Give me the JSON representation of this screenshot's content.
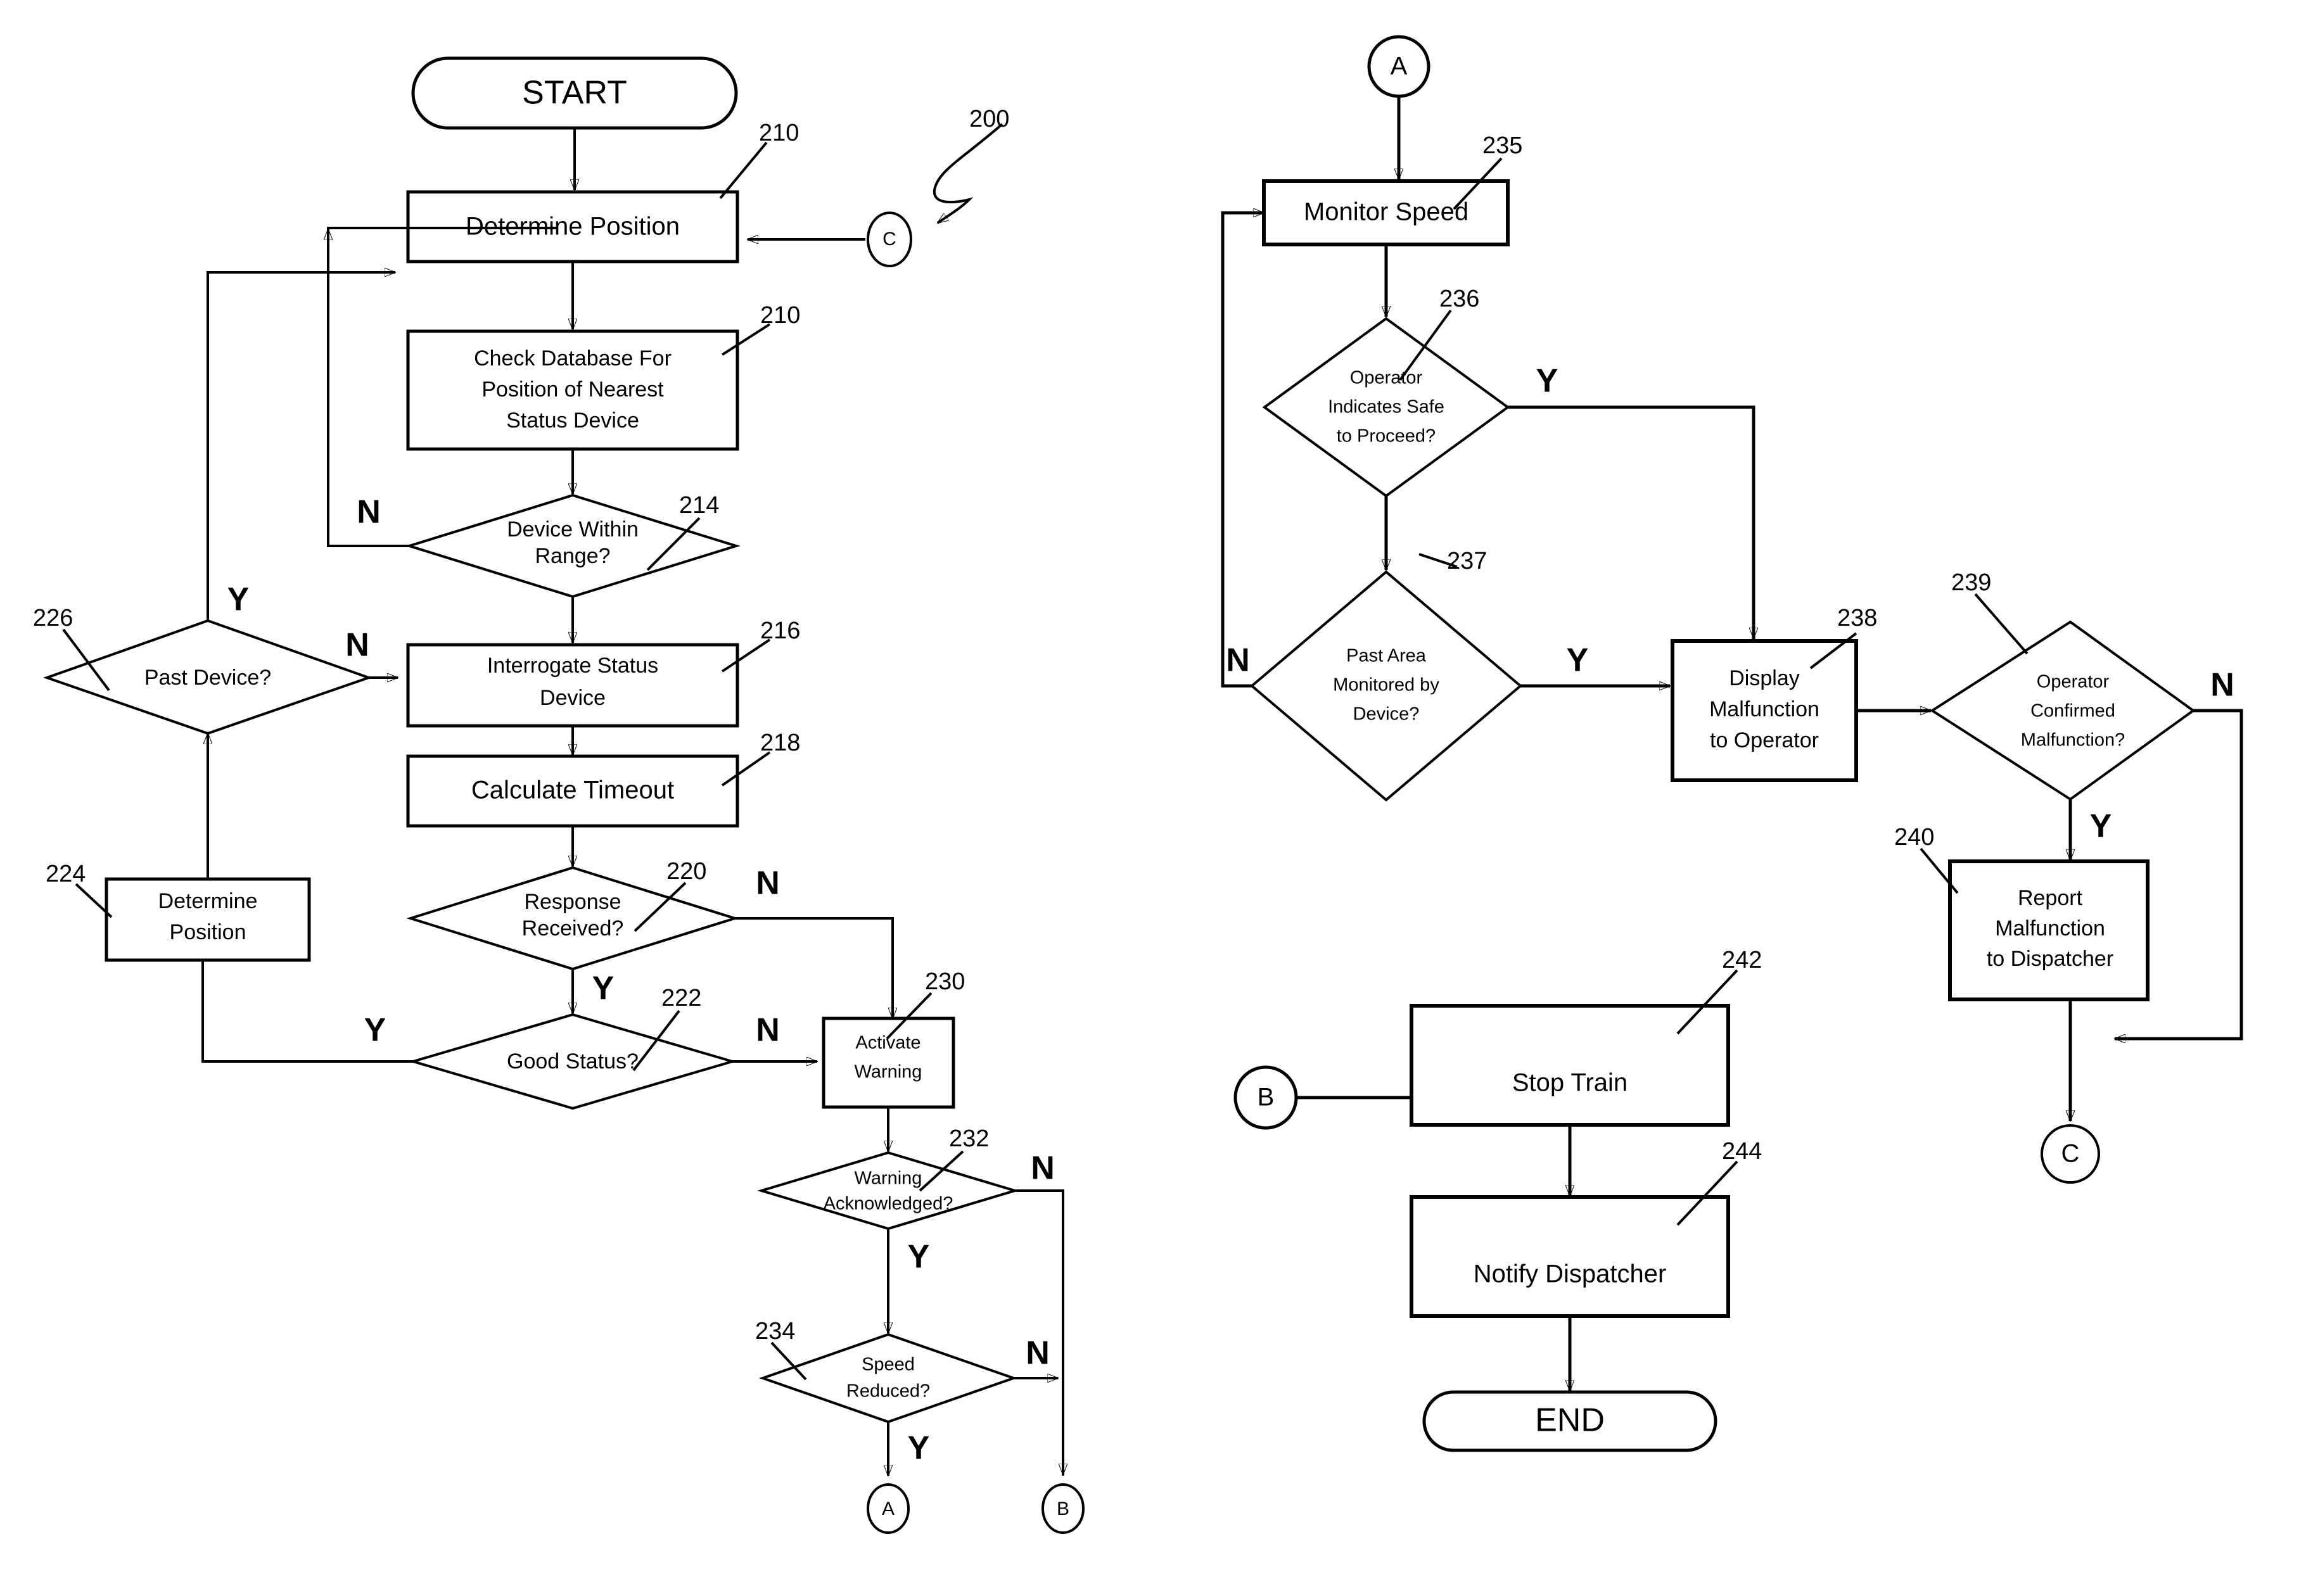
{
  "figure": {
    "reference_numeral": "200"
  },
  "nodes": {
    "start": {
      "label": "START",
      "type": "terminator"
    },
    "determine_position_1": {
      "label": "Determine Position",
      "ref": "210",
      "type": "process"
    },
    "check_database": {
      "line1": "Check Database For",
      "line2": "Position of Nearest",
      "line3": "Status Device",
      "ref": "210",
      "type": "process"
    },
    "device_within_range": {
      "line1": "Device Within",
      "line2": "Range?",
      "ref": "214",
      "type": "decision"
    },
    "interrogate_status_device": {
      "line1": "Interrogate Status",
      "line2": "Device",
      "ref": "216",
      "type": "process"
    },
    "calculate_timeout": {
      "label": "Calculate Timeout",
      "ref": "218",
      "type": "process"
    },
    "response_received": {
      "line1": "Response",
      "line2": "Received?",
      "ref": "220",
      "type": "decision"
    },
    "good_status": {
      "label": "Good Status?",
      "ref": "222",
      "type": "decision"
    },
    "determine_position_2": {
      "line1": "Determine",
      "line2": "Position",
      "ref": "224",
      "type": "process"
    },
    "past_device": {
      "label": "Past Device?",
      "ref": "226",
      "type": "decision"
    },
    "activate_warning": {
      "line1": "Activate",
      "line2": "Warning",
      "ref": "230",
      "type": "process"
    },
    "warning_acknowledged": {
      "line1": "Warning",
      "line2": "Acknowledged?",
      "ref": "232",
      "type": "decision"
    },
    "speed_reduced": {
      "line1": "Speed",
      "line2": "Reduced?",
      "ref": "234",
      "type": "decision"
    },
    "monitor_speed": {
      "label": "Monitor Speed",
      "ref": "235",
      "type": "process"
    },
    "operator_indicates_safe": {
      "line1": "Operator",
      "line2": "Indicates Safe",
      "line3": "to Proceed?",
      "ref": "236",
      "type": "decision"
    },
    "past_area_monitored": {
      "line1": "Past Area",
      "line2": "Monitored by",
      "line3": "Device?",
      "ref": "237",
      "type": "decision"
    },
    "display_malfunction": {
      "line1": "Display",
      "line2": "Malfunction",
      "line3": "to Operator",
      "ref": "238",
      "type": "process"
    },
    "operator_confirmed_malfunction": {
      "line1": "Operator",
      "line2": "Confirmed",
      "line3": "Malfunction?",
      "ref": "239",
      "type": "decision"
    },
    "report_malfunction": {
      "line1": "Report",
      "line2": "Malfunction",
      "line3": "to Dispatcher",
      "ref": "240",
      "type": "process"
    },
    "stop_train": {
      "label": "Stop Train",
      "ref": "242",
      "type": "process"
    },
    "notify_dispatcher": {
      "label": "Notify Dispatcher",
      "ref": "244",
      "type": "process"
    },
    "end": {
      "label": "END",
      "type": "terminator"
    }
  },
  "connectors": {
    "c_left": "C",
    "a_out": "A",
    "b_out": "B",
    "a_in": "A",
    "b_in": "B",
    "c_out": "C"
  },
  "edge_labels": {
    "device_within_range_no": "N",
    "past_device_yes": "Y",
    "past_device_no": "N",
    "response_received_no": "N",
    "response_received_yes": "Y",
    "good_status_yes": "Y",
    "good_status_no": "N",
    "warning_ack_no": "N",
    "warning_ack_yes": "Y",
    "speed_reduced_no": "N",
    "speed_reduced_yes": "Y",
    "operator_safe_yes": "Y",
    "past_area_no": "N",
    "past_area_yes": "Y",
    "operator_confirmed_no": "N",
    "operator_confirmed_yes": "Y"
  },
  "style": {
    "line_color": "#000000",
    "fill_color": "#ffffff"
  }
}
